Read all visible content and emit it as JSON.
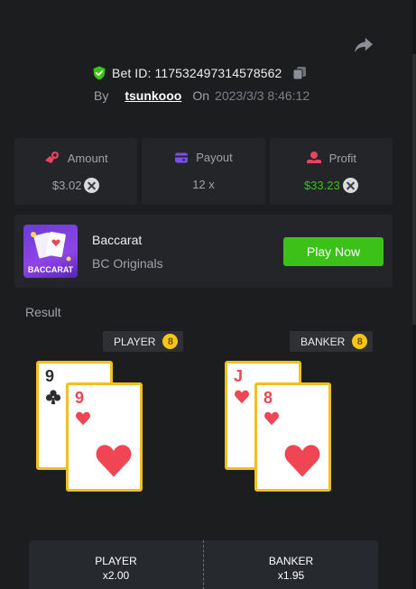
{
  "header": {
    "bet_id": "Bet ID: 117532497314578562",
    "by_label": "By",
    "username": "tsunkooo",
    "on_label": "On",
    "date": "2023/3/3 8:46:12"
  },
  "stats": {
    "amount": {
      "label": "Amount",
      "value": "$3.02",
      "color": "#9ea3aa"
    },
    "payout": {
      "label": "Payout",
      "value": "12 x",
      "color": "#9ea3aa"
    },
    "profit": {
      "label": "Profit",
      "value": "$33.23",
      "color": "#3bc117"
    }
  },
  "game": {
    "thumb_label": "BACCARAT",
    "name": "Baccarat",
    "provider": "BC Originals",
    "play_label": "Play Now"
  },
  "result": {
    "title": "Result",
    "player": {
      "label": "PLAYER",
      "score": "8",
      "cards": [
        {
          "rank": "9",
          "suit": "clubs",
          "color": "black"
        },
        {
          "rank": "9",
          "suit": "hearts",
          "color": "red"
        }
      ]
    },
    "banker": {
      "label": "BANKER",
      "score": "8",
      "cards": [
        {
          "rank": "J",
          "suit": "hearts",
          "color": "red"
        },
        {
          "rank": "8",
          "suit": "hearts",
          "color": "red"
        }
      ]
    }
  },
  "bets": {
    "player": {
      "label": "PLAYER",
      "odds": "x2.00"
    },
    "banker": {
      "label": "BANKER",
      "odds": "x1.95"
    }
  },
  "colors": {
    "background": "#1b1d1f",
    "panel": "#232528",
    "accent_green": "#3bc117",
    "card_border": "#f0c020",
    "heart_red": "#f04552"
  }
}
